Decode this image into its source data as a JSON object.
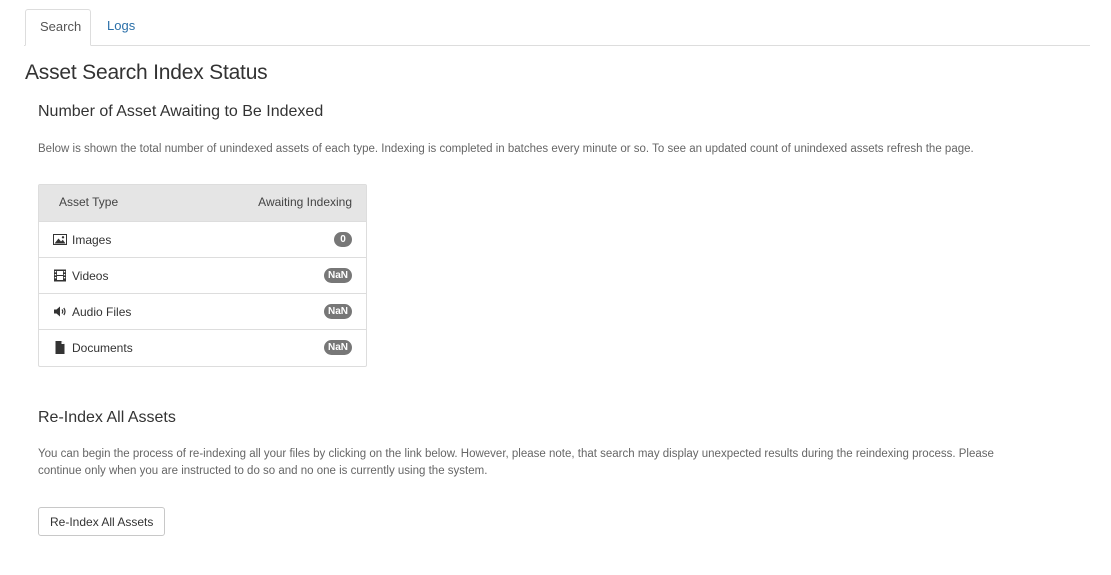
{
  "tabs": [
    {
      "label": "Search",
      "active": true
    },
    {
      "label": "Logs",
      "active": false
    }
  ],
  "page_title": "Asset Search Index Status",
  "awaiting": {
    "heading": "Number of Asset Awaiting to Be Indexed",
    "description": "Below is shown the total number of unindexed assets of each type. Indexing is completed in batches every minute or so. To see an updated count of unindexed assets refresh the page.",
    "table": {
      "columns": [
        "Asset Type",
        "Awaiting Indexing"
      ],
      "rows": [
        {
          "icon": "image-icon",
          "label": "Images",
          "count": "0"
        },
        {
          "icon": "film-icon",
          "label": "Videos",
          "count": "NaN"
        },
        {
          "icon": "volume-icon",
          "label": "Audio Files",
          "count": "NaN"
        },
        {
          "icon": "file-icon",
          "label": "Documents",
          "count": "NaN"
        }
      ]
    }
  },
  "reindex": {
    "heading": "Re-Index All Assets",
    "description": "You can begin the process of re-indexing all your files by clicking on the link below. However, please note, that search may display unexpected results during the reindexing process. Please continue only when you are instructed to do so and no one is currently using the system.",
    "button_label": "Re-Index All Assets"
  },
  "colors": {
    "link": "#2a6fa8",
    "badge": "#777777",
    "table_header": "#e5e5e5"
  }
}
